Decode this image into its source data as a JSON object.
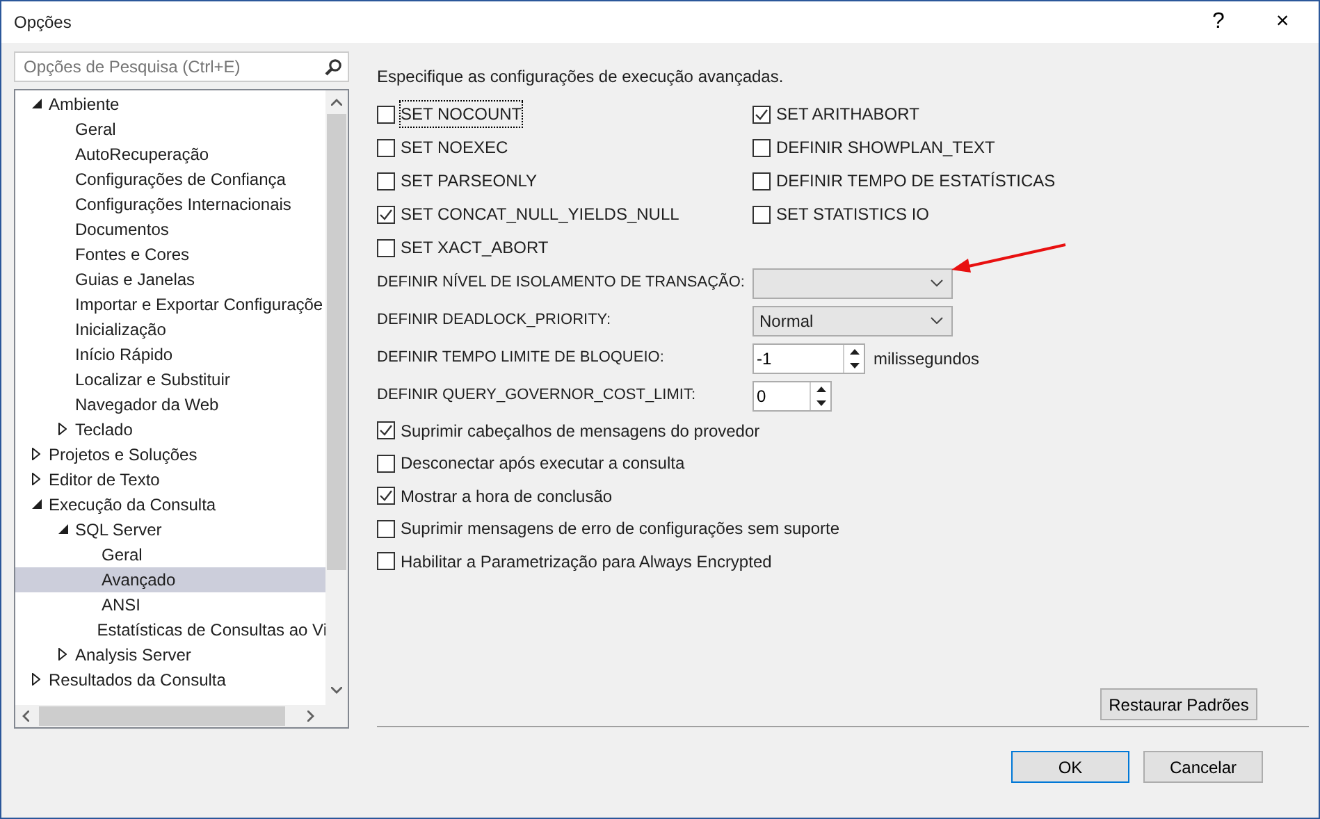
{
  "window": {
    "title": "Opções",
    "help": "?",
    "close": "×"
  },
  "search": {
    "placeholder": "Opções de Pesquisa (Ctrl+E)"
  },
  "tree": [
    {
      "label": "Ambiente",
      "expanded": true,
      "selected": false,
      "children": [
        {
          "label": "Geral",
          "selected": false
        },
        {
          "label": "AutoRecuperação",
          "selected": false
        },
        {
          "label": "Configurações de Confiança",
          "selected": false
        },
        {
          "label": "Configurações Internacionais",
          "selected": false
        },
        {
          "label": "Documentos",
          "selected": false
        },
        {
          "label": "Fontes e Cores",
          "selected": false
        },
        {
          "label": "Guias e Janelas",
          "selected": false
        },
        {
          "label": "Importar e Exportar Configuraçõe",
          "selected": false
        },
        {
          "label": "Inicialização",
          "selected": false
        },
        {
          "label": "Início Rápido",
          "selected": false
        },
        {
          "label": "Localizar e Substituir",
          "selected": false
        },
        {
          "label": "Navegador da Web",
          "selected": false
        },
        {
          "label": "Teclado",
          "expanded": false,
          "selected": false
        }
      ]
    },
    {
      "label": "Projetos e Soluções",
      "expanded": false,
      "selected": false
    },
    {
      "label": "Editor de Texto",
      "expanded": false,
      "selected": false
    },
    {
      "label": "Execução da Consulta",
      "expanded": true,
      "selected": false,
      "children": [
        {
          "label": "SQL Server",
          "expanded": true,
          "selected": false,
          "children": [
            {
              "label": "Geral",
              "selected": false
            },
            {
              "label": "Avançado",
              "selected": true
            },
            {
              "label": "ANSI",
              "selected": false
            },
            {
              "label": "Estatísticas de Consultas ao Vi",
              "selected": false
            }
          ]
        },
        {
          "label": "Analysis Server",
          "expanded": false,
          "selected": false
        }
      ]
    },
    {
      "label": "Resultados da Consulta",
      "expanded": false,
      "selected": false
    }
  ],
  "heading": "Especifique as configurações de execução avançadas.",
  "options_left": [
    {
      "label": "SET NOCOUNT",
      "checked": false,
      "focused": true
    },
    {
      "label": "SET NOEXEC",
      "checked": false
    },
    {
      "label": "SET PARSEONLY",
      "checked": false
    },
    {
      "label": "SET CONCAT_NULL_YIELDS_NULL",
      "checked": true
    },
    {
      "label": "SET XACT_ABORT",
      "checked": false
    }
  ],
  "options_right": [
    {
      "label": "SET ARITHABORT",
      "checked": true
    },
    {
      "label": "DEFINIR SHOWPLAN_TEXT",
      "checked": false
    },
    {
      "label": "DEFINIR TEMPO DE ESTATÍSTICAS",
      "checked": false
    },
    {
      "label": "SET STATISTICS IO",
      "checked": false
    }
  ],
  "fields": [
    {
      "kind": "combo",
      "label": "DEFINIR NÍVEL DE ISOLAMENTO DE TRANSAÇÃO:"
    },
    {
      "kind": "combo",
      "label": "DEFINIR DEADLOCK_PRIORITY:",
      "value": "Normal"
    },
    {
      "kind": "spin",
      "label": "DEFINIR TEMPO LIMITE DE BLOQUEIO:",
      "value": "-1",
      "unit": "milissegundos"
    },
    {
      "kind": "spin_small",
      "label": "DEFINIR QUERY_GOVERNOR_COST_LIMIT:",
      "value": "0"
    }
  ],
  "options_bottom": [
    {
      "label": "Suprimir cabeçalhos de mensagens do provedor",
      "checked": true
    },
    {
      "label": "Desconectar após executar a consulta",
      "checked": false
    },
    {
      "label": "Mostrar a hora de conclusão",
      "checked": true
    },
    {
      "label": "Suprimir mensagens de erro de configurações sem suporte",
      "checked": false
    },
    {
      "label": "Habilitar a Parametrização para Always Encrypted",
      "checked": false
    }
  ],
  "buttons": {
    "restore": "Restaurar Padrões",
    "ok": "OK",
    "cancel": "Cancelar"
  }
}
